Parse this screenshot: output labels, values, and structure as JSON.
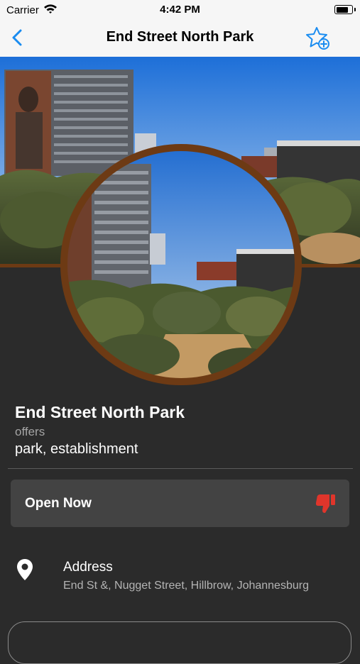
{
  "status_bar": {
    "carrier": "Carrier",
    "time": "4:42 PM",
    "battery_level": 0.9
  },
  "nav": {
    "title": "End Street North Park",
    "back_icon": "chevron-left-icon",
    "favorite_icon": "star-plus-icon",
    "accent_color": "#1a8cf0"
  },
  "place": {
    "name": "End Street North Park",
    "offers_label": "offers",
    "types": "park, establishment"
  },
  "status_card": {
    "label": "Open Now",
    "icon": "thumbs-down-icon",
    "icon_color": "#e0352b"
  },
  "address": {
    "icon": "location-pin-icon",
    "label": "Address",
    "value": "End St &, Nugget Street, Hillbrow, Johannesburg"
  },
  "colors": {
    "background": "#2b2b2b",
    "ring": "#6d3a14",
    "card": "#434343"
  }
}
